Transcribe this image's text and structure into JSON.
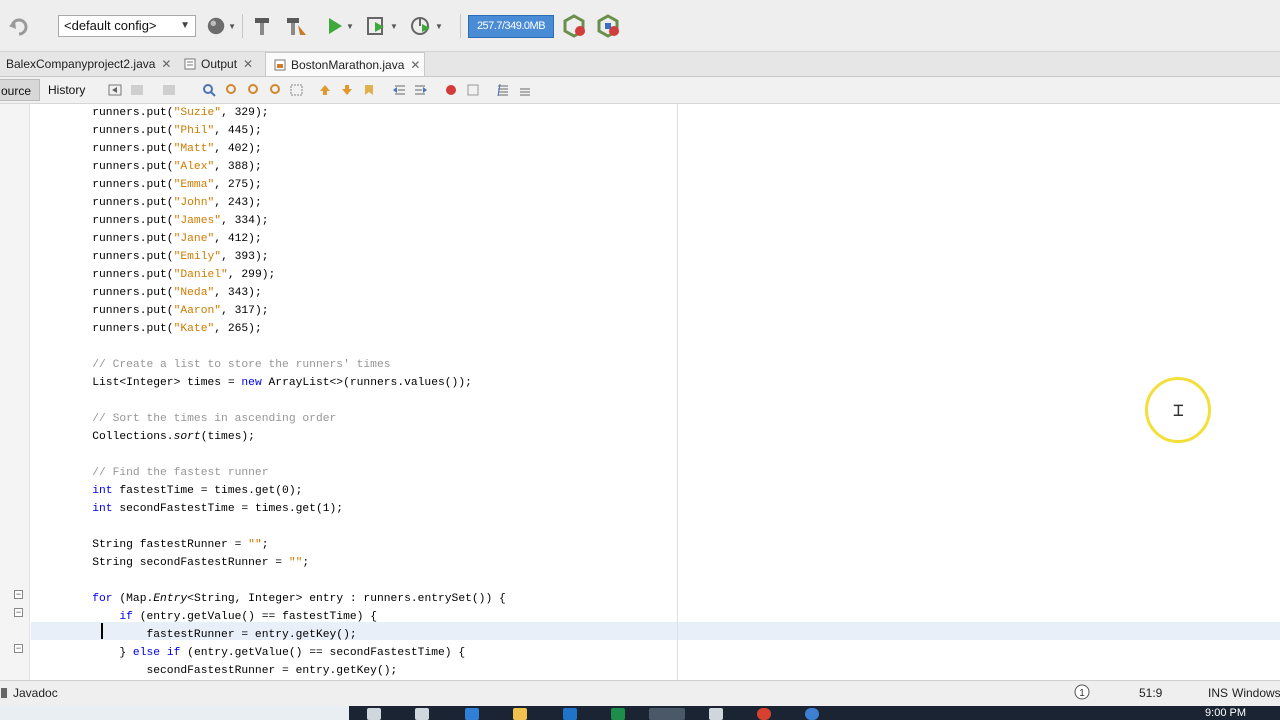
{
  "toolbar": {
    "config_value": "<default config>",
    "memory": "257.7/349.0MB",
    "icons": [
      "back-icon",
      "globe-icon",
      "build-icon",
      "clean-build-icon",
      "run-icon",
      "debug-icon",
      "profile-icon",
      "gc-icon",
      "profiler-icon"
    ]
  },
  "tabs": [
    {
      "label": "BalexCompanyproject2.java",
      "active": false
    },
    {
      "label": "Output",
      "active": false
    },
    {
      "label": "BostonMarathon.java",
      "active": true
    }
  ],
  "editor_toolbar": {
    "source_label": "ource",
    "history_label": "History"
  },
  "code_lines": [
    {
      "t": "code",
      "s": "        runners.put(\"Suzie\", 329);"
    },
    {
      "t": "code",
      "s": "        runners.put(\"Phil\", 445);"
    },
    {
      "t": "code",
      "s": "        runners.put(\"Matt\", 402);"
    },
    {
      "t": "code",
      "s": "        runners.put(\"Alex\", 388);"
    },
    {
      "t": "code",
      "s": "        runners.put(\"Emma\", 275);"
    },
    {
      "t": "code",
      "s": "        runners.put(\"John\", 243);"
    },
    {
      "t": "code",
      "s": "        runners.put(\"James\", 334);"
    },
    {
      "t": "code",
      "s": "        runners.put(\"Jane\", 412);"
    },
    {
      "t": "code",
      "s": "        runners.put(\"Emily\", 393);"
    },
    {
      "t": "code",
      "s": "        runners.put(\"Daniel\", 299);"
    },
    {
      "t": "code",
      "s": "        runners.put(\"Neda\", 343);"
    },
    {
      "t": "code",
      "s": "        runners.put(\"Aaron\", 317);"
    },
    {
      "t": "code",
      "s": "        runners.put(\"Kate\", 265);"
    },
    {
      "t": "code",
      "s": ""
    },
    {
      "t": "code",
      "s": "        // Create a list to store the runners' times"
    },
    {
      "t": "code",
      "s": "        List<Integer> times = new ArrayList<>(runners.values());"
    },
    {
      "t": "code",
      "s": ""
    },
    {
      "t": "code",
      "s": "        // Sort the times in ascending order"
    },
    {
      "t": "code",
      "s": "        Collections.sort(times);"
    },
    {
      "t": "code",
      "s": ""
    },
    {
      "t": "code",
      "s": "        // Find the fastest runner"
    },
    {
      "t": "code",
      "s": "        int fastestTime = times.get(0);"
    },
    {
      "t": "code",
      "s": "        int secondFastestTime = times.get(1);"
    },
    {
      "t": "code",
      "s": ""
    },
    {
      "t": "code",
      "s": "        String fastestRunner = \"\";"
    },
    {
      "t": "code",
      "s": "        String secondFastestRunner = \"\";"
    },
    {
      "t": "code",
      "s": ""
    },
    {
      "t": "code",
      "s": "        for (Map.Entry<String, Integer> entry : runners.entrySet()) {"
    },
    {
      "t": "code",
      "s": "            if (entry.getValue() == fastestTime) {"
    },
    {
      "t": "code",
      "s": "                fastestRunner = entry.getKey();"
    },
    {
      "t": "code",
      "s": "            } else if (entry.getValue() == secondFastestTime) {"
    },
    {
      "t": "code",
      "s": "                secondFastestRunner = entry.getKey();"
    }
  ],
  "status": {
    "panel": "Javadoc",
    "position": "51:9",
    "mode": "INS",
    "line_endings": "Windows"
  },
  "taskbar": {
    "clock": "9:00 PM"
  }
}
